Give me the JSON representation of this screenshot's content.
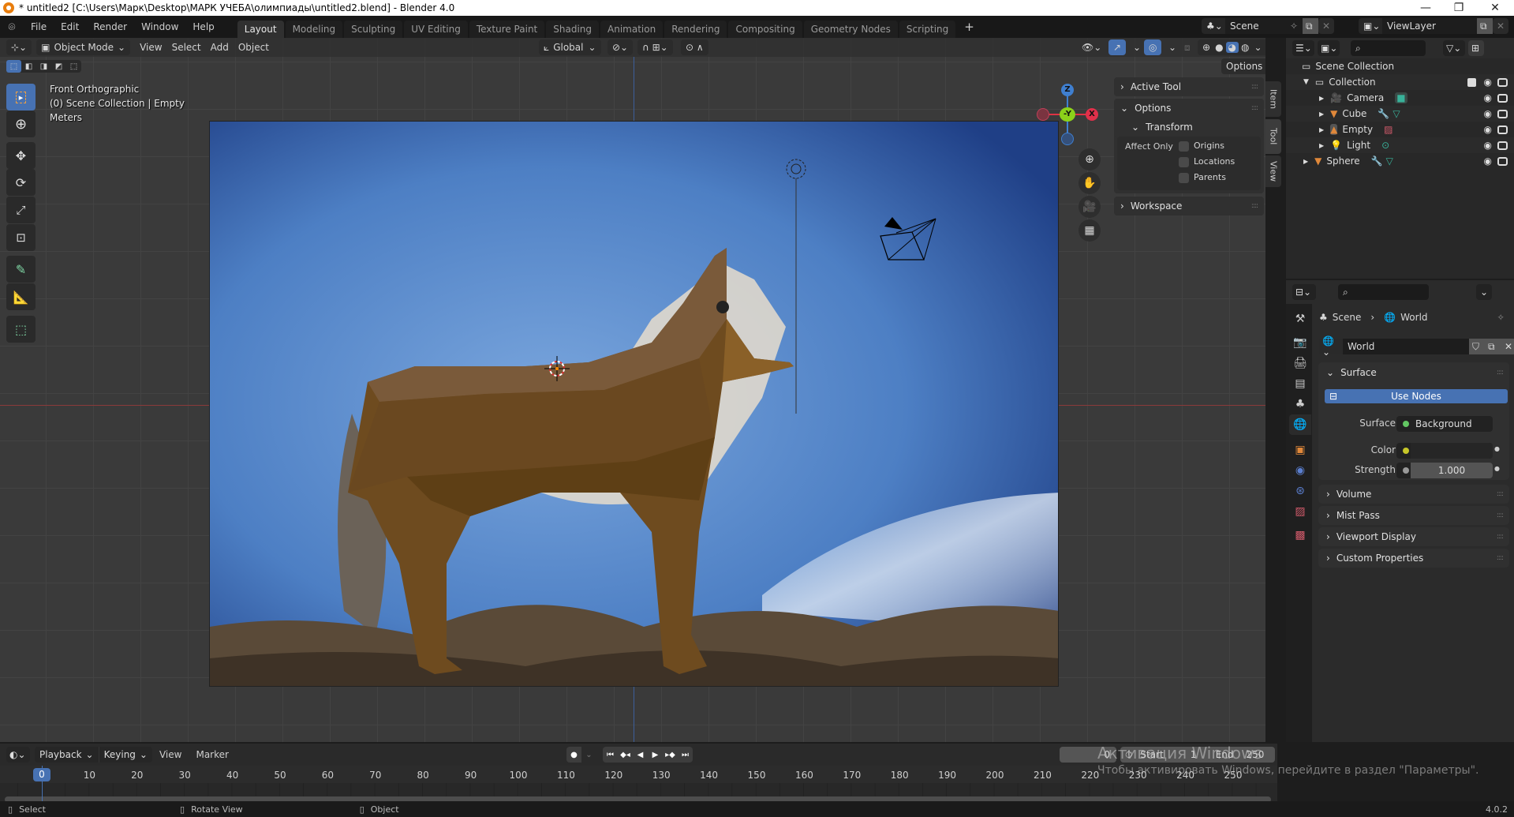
{
  "window": {
    "title": "* untitled2 [C:\\Users\\Марк\\Desktop\\МАРК УЧЕБА\\олимпиады\\untitled2.blend] - Blender 4.0",
    "controls": {
      "minimize": "—",
      "maximize": "❐",
      "close": "✕"
    }
  },
  "menu": [
    "File",
    "Edit",
    "Render",
    "Window",
    "Help"
  ],
  "workspaces": [
    {
      "label": "Layout",
      "active": true
    },
    {
      "label": "Modeling"
    },
    {
      "label": "Sculpting"
    },
    {
      "label": "UV Editing"
    },
    {
      "label": "Texture Paint"
    },
    {
      "label": "Shading"
    },
    {
      "label": "Animation"
    },
    {
      "label": "Rendering"
    },
    {
      "label": "Compositing"
    },
    {
      "label": "Geometry Nodes"
    },
    {
      "label": "Scripting"
    }
  ],
  "add_workspace": "+",
  "scene_selector": {
    "value": "Scene"
  },
  "viewlayer_selector": {
    "value": "ViewLayer"
  },
  "viewport_header": {
    "mode": "Object Mode",
    "menus": [
      "View",
      "Select",
      "Add",
      "Object"
    ],
    "orientation": "Global",
    "options_label": "Options"
  },
  "viewport_overlay": {
    "view_name": "Front Orthographic",
    "collection_info": "(0) Scene Collection | Empty",
    "units": "Meters"
  },
  "gizmo": {
    "z": "Z",
    "y": "-Y",
    "x": "X"
  },
  "tools": [
    "select-box",
    "cursor",
    "move",
    "rotate",
    "scale",
    "transform",
    "annotate",
    "measure",
    "add-cube"
  ],
  "n_panel": {
    "tabs": [
      "Item",
      "Tool",
      "View"
    ],
    "active_tab": "Tool",
    "sections": {
      "active_tool": "Active Tool",
      "options": "Options",
      "transform": "Transform",
      "affect_only": "Affect Only",
      "origins": "Origins",
      "locations": "Locations",
      "parents": "Parents",
      "workspace": "Workspace"
    }
  },
  "outliner": {
    "root": "Scene Collection",
    "items": [
      {
        "name": "Collection",
        "depth": 0
      },
      {
        "name": "Camera",
        "depth": 1
      },
      {
        "name": "Cube",
        "depth": 1
      },
      {
        "name": "Empty",
        "depth": 1
      },
      {
        "name": "Light",
        "depth": 1
      },
      {
        "name": "Sphere",
        "depth": 0
      }
    ]
  },
  "properties": {
    "breadcrumb": {
      "scene": "Scene",
      "world": "World"
    },
    "datablock": "World",
    "surface_panel": "Surface",
    "use_nodes": "Use Nodes",
    "surface_label": "Surface",
    "surface_value": "Background",
    "color_label": "Color",
    "strength_label": "Strength",
    "strength_value": "1.000",
    "panels": [
      "Volume",
      "Mist Pass",
      "Viewport Display",
      "Custom Properties"
    ],
    "colors": {
      "accent": "#4772b3",
      "surface_socket": "#63c763",
      "color_socket": "#c7c729",
      "world_tab": "#e25a5a"
    }
  },
  "timeline": {
    "menus": [
      "Playback",
      "Keying",
      "View",
      "Marker"
    ],
    "current_frame": "0",
    "current_frame_field": "0",
    "start_label": "Start",
    "start_value": "1",
    "end_label": "End",
    "end_value": "250",
    "ticks": [
      "10",
      "20",
      "30",
      "40",
      "50",
      "60",
      "70",
      "80",
      "90",
      "100",
      "110",
      "120",
      "130",
      "140",
      "150",
      "160",
      "170",
      "180",
      "190",
      "200",
      "210",
      "220",
      "230",
      "240",
      "250"
    ]
  },
  "statusbar": {
    "select": "Select",
    "rotate": "Rotate View",
    "object": "Object",
    "version": "4.0.2"
  },
  "watermark": {
    "line1": "Активация Windows",
    "line2": "Чтобы активировать Windows, перейдите в раздел \"Параметры\"."
  }
}
